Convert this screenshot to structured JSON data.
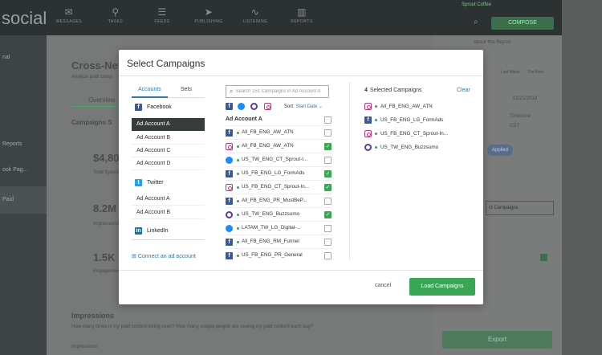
{
  "app": {
    "brand": "social",
    "nav": [
      "MESSAGES",
      "TASKS",
      "FEEDS",
      "PUBLISHING",
      "LISTENING",
      "REPORTS"
    ],
    "compose_label": "COMPOSE",
    "user": "Sprout Coffee",
    "sidebar": [
      "nal",
      "",
      "",
      "Reports",
      "ook Pag...",
      "Paid"
    ]
  },
  "background": {
    "page_title": "Cross-Netw",
    "page_sub": "Analyze paid camp",
    "tab": "Overview",
    "section": "Campaigns S",
    "metrics": [
      {
        "value": "$4,80",
        "label": "Total Spend"
      },
      {
        "value": "8.2M",
        "label": "Impressions"
      },
      {
        "value": "1.5K",
        "label": "Engagements"
      }
    ],
    "impressions_title": "Impressions",
    "impressions_sub": "How many times is my paid content being seen? How many unique people are seeing my paid content each day?",
    "impressions_footer": "Impressions",
    "right": {
      "about": "About this Report",
      "last_week": "Last Week",
      "the_new": "The New",
      "date": "01/21/2018",
      "timezone": "Timezone",
      "cdt": "CDT",
      "applied": "Applied",
      "campaigns_btn": "ct Campaigns",
      "export": "Export"
    }
  },
  "modal": {
    "title": "Select Campaigns",
    "tabs": {
      "accounts": "Accounts",
      "sets": "Sets"
    },
    "networks": [
      {
        "name": "Facebook",
        "icon": "facebook-icon",
        "accounts": [
          "Ad Account A",
          "Ad Account B",
          "Ad Account C",
          "Ad Account D"
        ],
        "selected": "Ad Account A"
      },
      {
        "name": "Twitter",
        "icon": "twitter-icon",
        "accounts": [
          "Ad Account A",
          "Ad Account B"
        ]
      },
      {
        "name": "LinkedIn",
        "icon": "linkedin-icon",
        "accounts": []
      }
    ],
    "connect_label": "Connect an ad account",
    "search_placeholder": "Search 151 Campaigns in Ad Account A",
    "sort_label": "Sort:",
    "sort_value": "Start Date",
    "list_header": "Ad Account A",
    "campaigns": [
      {
        "name": "All_FB_ENG_AW_ATN",
        "icon": "facebook-icon",
        "checked": false
      },
      {
        "name": "All_FB_ENG_AW_ATN",
        "icon": "instagram-icon",
        "checked": true
      },
      {
        "name": "US_TW_ENG_CT_Sprout-I...",
        "icon": "messenger-icon",
        "checked": false
      },
      {
        "name": "US_FB_ENG_LG_FormAds",
        "icon": "facebook-icon",
        "checked": true
      },
      {
        "name": "US_FB_ENG_CT_Sprout-In...",
        "icon": "instagram-icon",
        "checked": true
      },
      {
        "name": "All_FB_ENG_PR_MustBeP...",
        "icon": "facebook-icon",
        "checked": false
      },
      {
        "name": "US_TW_ENG_Buzzsumo",
        "icon": "audience-network-icon",
        "checked": true
      },
      {
        "name": "LATAM_TW_LG_Digital-...",
        "icon": "messenger-icon",
        "checked": false
      },
      {
        "name": "All_FB_ENG_RM_Funnel",
        "icon": "facebook-icon",
        "checked": false
      },
      {
        "name": "US_FB_ENG_PR_General",
        "icon": "facebook-icon",
        "checked": false
      }
    ],
    "selected_count": "4",
    "selected_label": "Selected Campaigns",
    "clear_label": "Clear",
    "selected": [
      {
        "name": "All_FB_ENG_AW_ATN",
        "icon": "instagram-icon"
      },
      {
        "name": "US_FB_ENG_LG_FormAds",
        "icon": "facebook-icon"
      },
      {
        "name": "US_FB_ENG_CT_Sprout-In...",
        "icon": "instagram-icon"
      },
      {
        "name": "US_TW_ENG_Buzzsumo",
        "icon": "audience-network-icon"
      }
    ],
    "cancel_label": "cancel",
    "load_label": "Load Campaigns",
    "accent": "#3aa655",
    "link_color": "#2a7ab0"
  }
}
